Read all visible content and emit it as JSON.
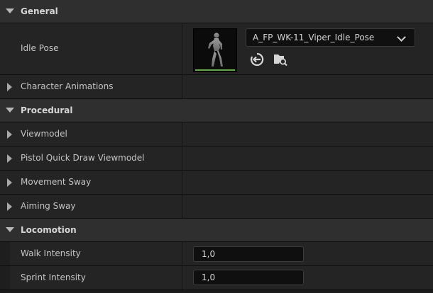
{
  "categories": {
    "general": "General",
    "procedural": "Procedural",
    "locomotion": "Locomotion"
  },
  "properties": {
    "idle_pose": {
      "label": "Idle Pose",
      "asset": "A_FP_WK-11_Viper_Idle_Pose"
    },
    "character_animations": "Character Animations",
    "viewmodel": "Viewmodel",
    "pistol_quick_draw_viewmodel": "Pistol Quick Draw Viewmodel",
    "movement_sway": "Movement Sway",
    "aiming_sway": "Aiming Sway",
    "walk_intensity": {
      "label": "Walk Intensity",
      "value": "1,0"
    },
    "sprint_intensity": {
      "label": "Sprint Intensity",
      "value": "1,0"
    }
  },
  "icons": {
    "combo_arrow": "chevron-down-icon",
    "use_selected": "arrow-left-circle-icon",
    "browse": "folder-search-icon",
    "expand": "chevron-right-icon",
    "collapse": "chevron-down-icon"
  },
  "colors": {
    "thumbnail_bar": "#5fae3e"
  }
}
